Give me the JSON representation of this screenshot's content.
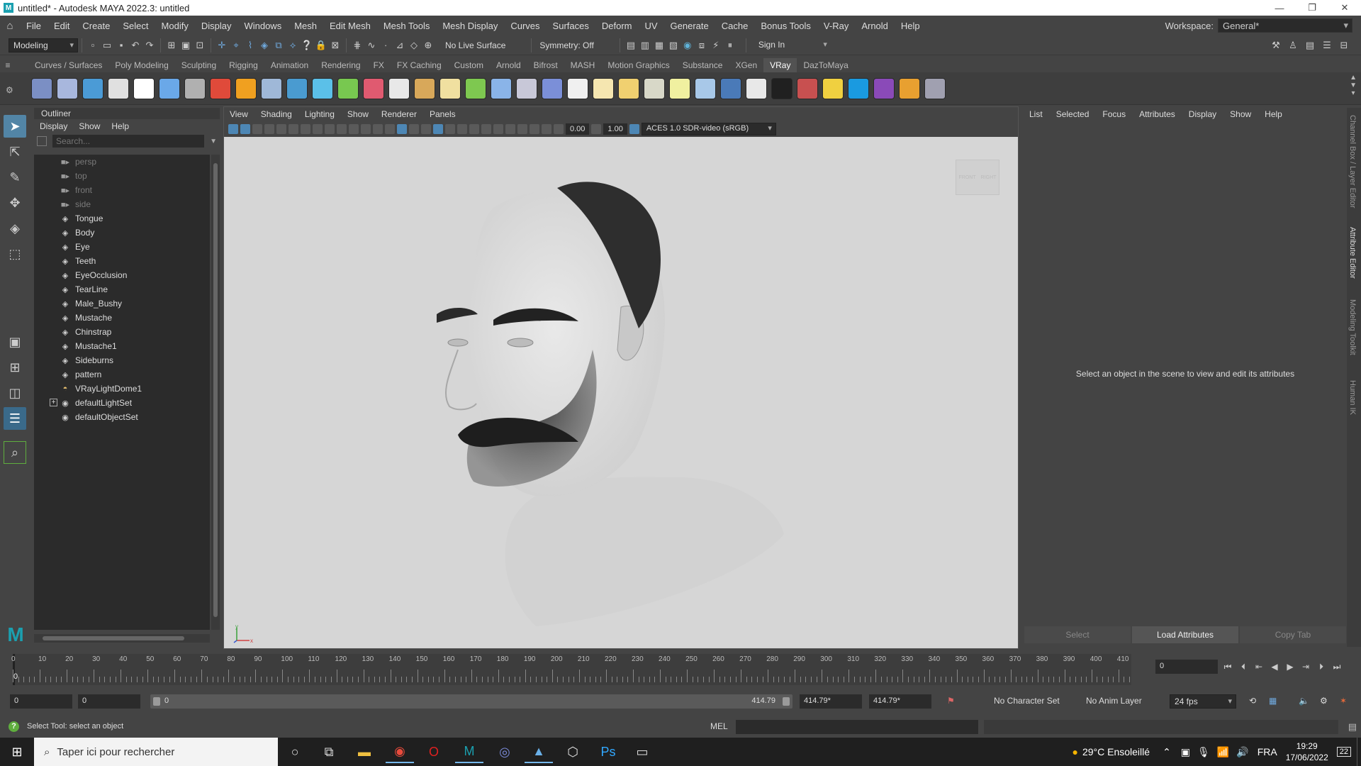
{
  "window": {
    "title": "untitled* - Autodesk MAYA 2022.3: untitled",
    "app_letter": "M",
    "minimize": "—",
    "maximize": "❐",
    "close": "✕"
  },
  "menubar": {
    "items": [
      "File",
      "Edit",
      "Create",
      "Select",
      "Modify",
      "Display",
      "Windows",
      "Mesh",
      "Edit Mesh",
      "Mesh Tools",
      "Mesh Display",
      "Curves",
      "Surfaces",
      "Deform",
      "UV",
      "Generate",
      "Cache",
      "Bonus Tools",
      "V-Ray",
      "Arnold",
      "Help"
    ],
    "workspace_label": "Workspace:",
    "workspace_value": "General*"
  },
  "statusline": {
    "menuset": "Modeling",
    "live_surface": "No Live Surface",
    "symmetry": "Symmetry: Off",
    "sign_in": "Sign In"
  },
  "shelf": {
    "tabs": [
      "Curves / Surfaces",
      "Poly Modeling",
      "Sculpting",
      "Rigging",
      "Animation",
      "Rendering",
      "FX",
      "FX Caching",
      "Custom",
      "Arnold",
      "Bifrost",
      "MASH",
      "Motion Graphics",
      "Substance",
      "XGen",
      "VRay",
      "DazToMaya"
    ],
    "active_tab": "VRay",
    "icon_colors": [
      "#7b8fc4",
      "#a8b7dd",
      "#4b9bd6",
      "#e0e0e0",
      "#ffffff",
      "#6aa8e8",
      "#b0b0b0",
      "#e04a3a",
      "#f0a020",
      "#9fb8d8",
      "#4a9bd0",
      "#5bc0e8",
      "#78c850",
      "#e05a70",
      "#e8e8e8",
      "#d8a85a",
      "#f0e0a0",
      "#7ec850",
      "#8ab4e8",
      "#c8c8d8",
      "#7b8fd8",
      "#f0f0f0",
      "#f5e6b0",
      "#f0d070",
      "#d8d8c8",
      "#f0f0a0",
      "#a8c8e8",
      "#4a7ab8",
      "#e8e8e8",
      "#202020",
      "#c85050",
      "#f0d040",
      "#1a9ae0",
      "#8a4ab8",
      "#e8a030",
      "#a0a0b0"
    ]
  },
  "outliner": {
    "title": "Outliner",
    "menu": [
      "Display",
      "Show",
      "Help"
    ],
    "search_placeholder": "Search...",
    "items": [
      {
        "name": "persp",
        "kind": "camera"
      },
      {
        "name": "top",
        "kind": "camera"
      },
      {
        "name": "front",
        "kind": "camera"
      },
      {
        "name": "side",
        "kind": "camera"
      },
      {
        "name": "Tongue",
        "kind": "mesh"
      },
      {
        "name": "Body",
        "kind": "mesh"
      },
      {
        "name": "Eye",
        "kind": "mesh"
      },
      {
        "name": "Teeth",
        "kind": "mesh"
      },
      {
        "name": "EyeOcclusion",
        "kind": "mesh"
      },
      {
        "name": "TearLine",
        "kind": "mesh"
      },
      {
        "name": "Male_Bushy",
        "kind": "mesh"
      },
      {
        "name": "Mustache",
        "kind": "mesh"
      },
      {
        "name": "Chinstrap",
        "kind": "mesh"
      },
      {
        "name": "Mustache1",
        "kind": "mesh"
      },
      {
        "name": "Sideburns",
        "kind": "mesh"
      },
      {
        "name": "pattern",
        "kind": "mesh"
      },
      {
        "name": "VRayLightDome1",
        "kind": "light"
      },
      {
        "name": "defaultLightSet",
        "kind": "set",
        "expandable": true
      },
      {
        "name": "defaultObjectSet",
        "kind": "set"
      }
    ]
  },
  "viewport": {
    "menu": [
      "View",
      "Shading",
      "Lighting",
      "Show",
      "Renderer",
      "Panels"
    ],
    "exposure": "0.00",
    "gamma": "1.00",
    "color_space": "ACES 1.0 SDR-video (sRGB)",
    "viewcube_left": "FRONT",
    "viewcube_right": "RIGHT",
    "axis_x": "x",
    "axis_y": "y"
  },
  "attribute_editor": {
    "menu": [
      "List",
      "Selected",
      "Focus",
      "Attributes",
      "Display",
      "Show",
      "Help"
    ],
    "empty_message": "Select an object in the scene to view and edit its attributes",
    "buttons": [
      "Select",
      "Load Attributes",
      "Copy Tab"
    ]
  },
  "side_tabs": [
    "Channel Box / Layer Editor",
    "Attribute Editor",
    "Modeling Toolkit",
    "Human IK"
  ],
  "timeline": {
    "tick_labels": [
      "0",
      "10",
      "20",
      "30",
      "40",
      "50",
      "60",
      "70",
      "80",
      "90",
      "100",
      "110",
      "120",
      "130",
      "140",
      "150",
      "160",
      "170",
      "180",
      "190",
      "200",
      "210",
      "220",
      "230",
      "240",
      "250",
      "260",
      "270",
      "280",
      "290",
      "300",
      "310",
      "320",
      "330",
      "340",
      "350",
      "360",
      "370",
      "380",
      "390",
      "400",
      "410"
    ],
    "current_frame_marker": "0",
    "current_frame": "0"
  },
  "range": {
    "scene_start": "0",
    "playback_start": "0",
    "range_start": "0",
    "range_end": "414.79",
    "playback_end": "414.79*",
    "scene_end": "414.79*",
    "character_set": "No Character Set",
    "anim_layer": "No Anim Layer",
    "fps": "24 fps"
  },
  "command_line": {
    "help_text": "Select Tool: select an object",
    "language": "MEL"
  },
  "taskbar": {
    "search_placeholder": "Taper ici pour rechercher",
    "weather": "29°C  Ensoleillé",
    "language": "FRA",
    "time": "19:29",
    "date": "17/06/2022",
    "notifications": "22"
  }
}
